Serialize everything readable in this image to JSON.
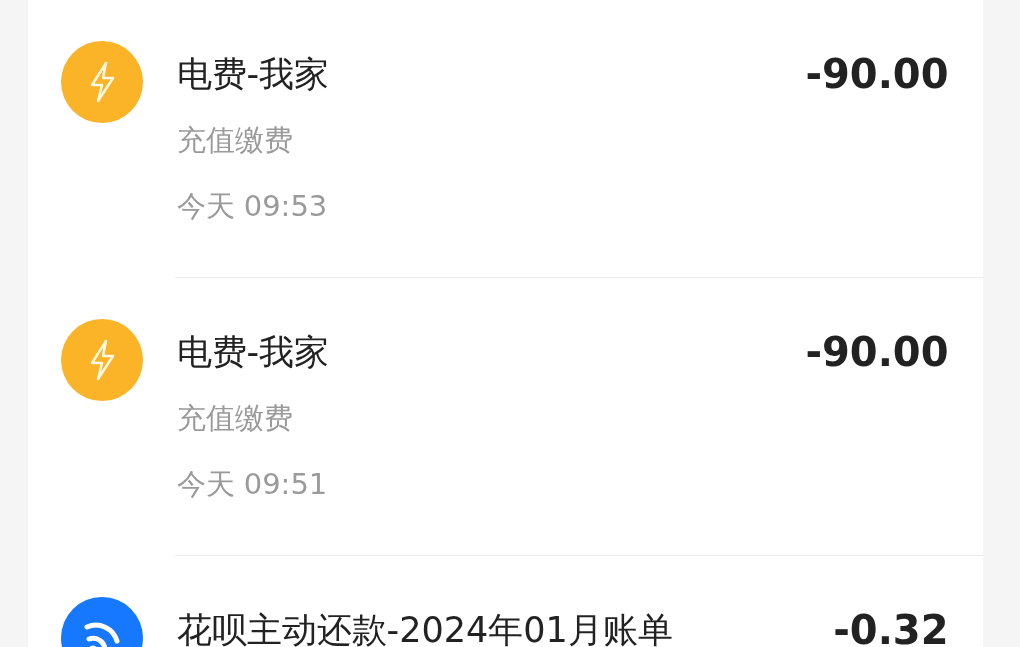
{
  "transactions": [
    {
      "kind": "bolt",
      "color": "#fbb328",
      "title": "电费-我家",
      "amount": "-90.00",
      "category": "充值缴费",
      "time": "今天 09:53"
    },
    {
      "kind": "bolt",
      "color": "#fbb328",
      "title": "电费-我家",
      "amount": "-90.00",
      "category": "充值缴费",
      "time": "今天 09:51"
    },
    {
      "kind": "wave",
      "color": "#1677ff",
      "title": "花呗主动还款-2024年01月账单",
      "amount": "-0.32"
    }
  ]
}
